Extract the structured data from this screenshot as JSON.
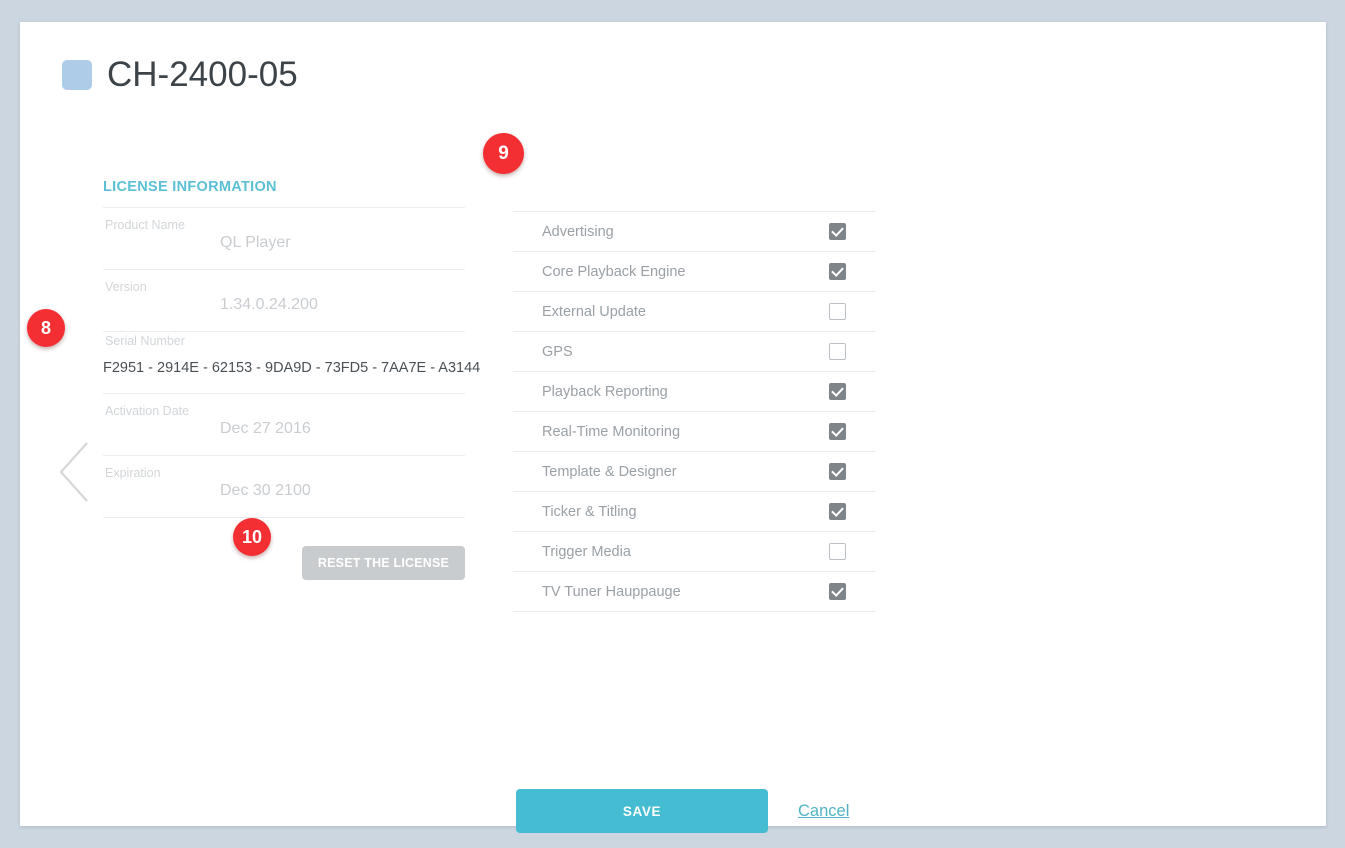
{
  "page": {
    "background_color": "#ccd6e0",
    "card_background": "#ffffff"
  },
  "header": {
    "title": "CH-2400-05",
    "swatch_color": "#aecbe8"
  },
  "back": {
    "icon": "chevron-left-icon"
  },
  "license": {
    "section_title": "LICENSE INFORMATION",
    "accent_color": "#5bc0d4",
    "fields": [
      {
        "label": "Product Name",
        "value": "QL Player"
      },
      {
        "label": "Version",
        "value": "1.34.0.24.200"
      },
      {
        "label": "Serial Number",
        "value": "F2951 - 2914E - 62153 - 9DA9D - 73FD5 - 7AA7E - A3144"
      },
      {
        "label": "Activation Date",
        "value": "Dec 27 2016"
      },
      {
        "label": "Expiration",
        "value": "Dec 30 2100"
      }
    ],
    "reset_button_label": "RESET THE LICENSE"
  },
  "features": {
    "items": [
      {
        "label": "Advertising",
        "checked": true
      },
      {
        "label": "Core Playback Engine",
        "checked": true
      },
      {
        "label": "External Update",
        "checked": false
      },
      {
        "label": "GPS",
        "checked": false
      },
      {
        "label": "Playback Reporting",
        "checked": true
      },
      {
        "label": "Real-Time Monitoring",
        "checked": true
      },
      {
        "label": "Template & Designer",
        "checked": true
      },
      {
        "label": "Ticker & Titling",
        "checked": true
      },
      {
        "label": "Trigger Media",
        "checked": false
      },
      {
        "label": "TV Tuner Hauppauge",
        "checked": true
      }
    ]
  },
  "footer": {
    "save_label": "SAVE",
    "cancel_label": "Cancel",
    "save_color": "#45bcd2"
  },
  "callouts": [
    {
      "number": "8"
    },
    {
      "number": "9"
    },
    {
      "number": "10"
    }
  ]
}
